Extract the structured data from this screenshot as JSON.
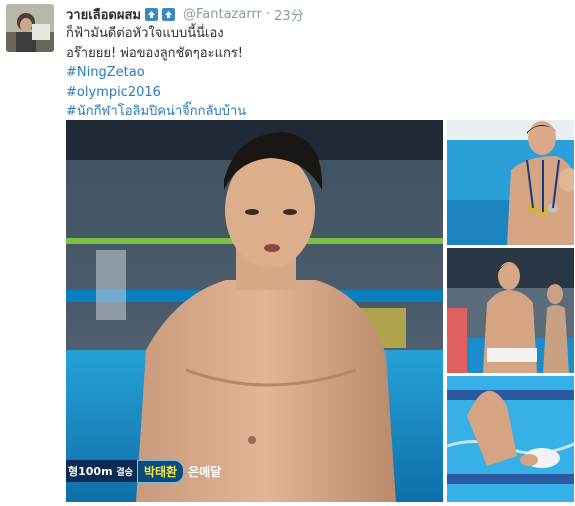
{
  "tweet": {
    "display_name": "วายเลือดผสม",
    "handle": "@Fantazarrr",
    "separator": "·",
    "time": "23分",
    "lines": [
      "ก็ฟ้ามันดีต่อหัวใจแบบนี้นี่เอง",
      "อร๊ายยย! พ่อของลูกชัดๆอะแกร!"
    ],
    "hashtags": [
      "#NingZetao",
      "#olympic2016",
      "#นักกีฬาโอลิมปิคน่าจิ๊กกลับบ้าน"
    ],
    "emoji_icons": [
      "up-arrow-icon",
      "up-arrow-icon"
    ]
  },
  "media": {
    "caption": {
      "event": "형100m",
      "event_suffix": "결승",
      "name": "박태환",
      "medal": "은메달"
    }
  },
  "colors": {
    "hashtag": "#2b7bb9",
    "handle": "#8899a6",
    "emoji_box": "#3b88c3",
    "pool_blue": "#1e8fc8"
  }
}
